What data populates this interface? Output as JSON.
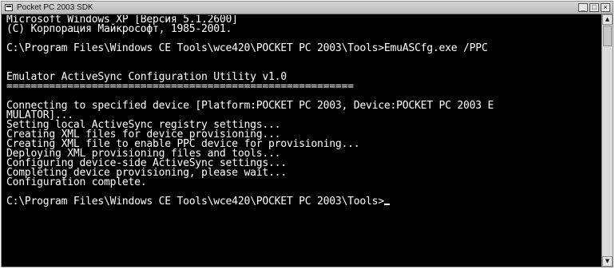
{
  "window": {
    "title": "Pocket PC 2003 SDK",
    "icon": "console-window-icon",
    "buttons": {
      "minimize": "_",
      "maximize": "□",
      "close": "×"
    }
  },
  "console": {
    "lines": [
      "Microsoft Windows XP [Версия 5.1.2600]",
      "(С) Корпорация Майкрософт, 1985-2001.",
      "",
      "C:\\Program Files\\Windows CE Tools\\wce420\\POCKET PC 2003\\Tools>EmuASCfg.exe /PPC",
      "",
      "",
      "Emulator ActiveSync Configuration Utility v1.0",
      "=========================================================",
      "",
      "Connecting to specified device [Platform:POCKET PC 2003, Device:POCKET PC 2003 E",
      "MULATOR]...",
      "Setting local ActiveSync registry settings...",
      "Creating XML files for device provisioning...",
      "Creating XML file to enable PPC device for provisioning...",
      "Deploying XML provisioning files and tools...",
      "Configuring device-side ActiveSync settings...",
      "Completing device provisioning, please wait...",
      "Configuration complete.",
      "",
      "C:\\Program Files\\Windows CE Tools\\wce420\\POCKET PC 2003\\Tools>"
    ]
  },
  "scrollbar": {
    "up_arrow": "▲",
    "down_arrow": "▼"
  }
}
